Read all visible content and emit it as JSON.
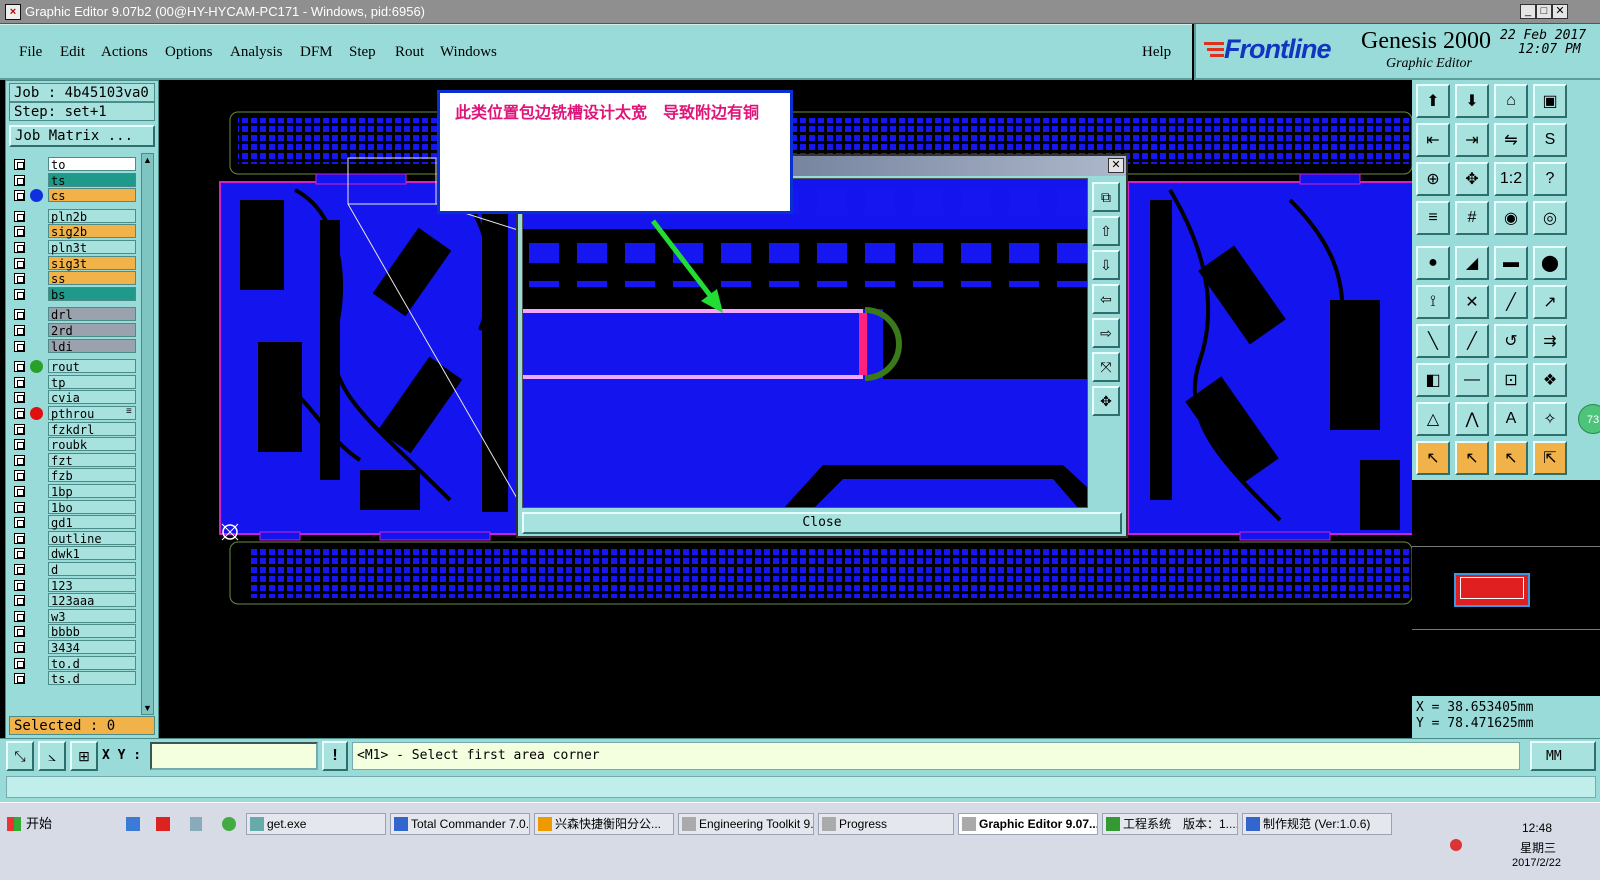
{
  "window": {
    "title": "Graphic Editor 9.07b2 (00@HY-HYCAM-PC171 - Windows, pid:6956)",
    "controls": [
      "_",
      "□",
      "✕"
    ]
  },
  "menu": {
    "items": [
      "File",
      "Edit",
      "Actions",
      "Options",
      "Analysis",
      "DFM",
      "Step",
      "Rout",
      "Windows"
    ],
    "help": "Help"
  },
  "brand": {
    "logo": "Frontline",
    "product": "Genesis 2000",
    "subtitle": "Graphic Editor",
    "date": "22 Feb 2017",
    "time": "12:07 PM"
  },
  "job": {
    "job_label": "Job : 4b45103va0",
    "step_label": "Step: set+1",
    "matrix_button": "Job Matrix ...",
    "selected": "Selected : 0"
  },
  "layers": [
    {
      "name": "to",
      "bg": "#ffffff",
      "dot": ""
    },
    {
      "name": "ts",
      "bg": "#1f9a8a",
      "dot": ""
    },
    {
      "name": "cs",
      "bg": "#f2b24a",
      "dot": "#1030e0"
    },
    {
      "name": "pln2b",
      "bg": "#a8e2df",
      "dot": ""
    },
    {
      "name": "sig2b",
      "bg": "#f2b24a",
      "dot": ""
    },
    {
      "name": "pln3t",
      "bg": "#a8e2df",
      "dot": ""
    },
    {
      "name": "sig3t",
      "bg": "#f2b24a",
      "dot": ""
    },
    {
      "name": "ss",
      "bg": "#f2b24a",
      "dot": ""
    },
    {
      "name": "bs",
      "bg": "#1f9a8a",
      "dot": ""
    },
    {
      "name": "drl",
      "bg": "#9aa3ad",
      "dot": ""
    },
    {
      "name": "2rd",
      "bg": "#9aa3ad",
      "dot": ""
    },
    {
      "name": "ldi",
      "bg": "#9aa3ad",
      "dot": ""
    },
    {
      "name": "rout",
      "bg": "#a8e2df",
      "dot": "#2aa02a"
    },
    {
      "name": "tp",
      "bg": "#a8e2df",
      "dot": ""
    },
    {
      "name": "cvia",
      "bg": "#a8e2df",
      "dot": ""
    },
    {
      "name": "pthrou",
      "bg": "#a8e2df",
      "dot": "#e01010",
      "mark": "≡"
    },
    {
      "name": "fzkdrl",
      "bg": "#a8e2df",
      "dot": ""
    },
    {
      "name": "roubk",
      "bg": "#a8e2df",
      "dot": ""
    },
    {
      "name": "fzt",
      "bg": "#a8e2df",
      "dot": ""
    },
    {
      "name": "fzb",
      "bg": "#a8e2df",
      "dot": ""
    },
    {
      "name": "1bp",
      "bg": "#a8e2df",
      "dot": ""
    },
    {
      "name": "1bo",
      "bg": "#a8e2df",
      "dot": ""
    },
    {
      "name": "gd1",
      "bg": "#a8e2df",
      "dot": ""
    },
    {
      "name": "outline",
      "bg": "#a8e2df",
      "dot": ""
    },
    {
      "name": "dwk1",
      "bg": "#a8e2df",
      "dot": ""
    },
    {
      "name": "d",
      "bg": "#a8e2df",
      "dot": ""
    },
    {
      "name": "123",
      "bg": "#a8e2df",
      "dot": ""
    },
    {
      "name": "123aaa",
      "bg": "#a8e2df",
      "dot": ""
    },
    {
      "name": "w3",
      "bg": "#a8e2df",
      "dot": ""
    },
    {
      "name": "bbbb",
      "bg": "#a8e2df",
      "dot": ""
    },
    {
      "name": "3434",
      "bg": "#a8e2df",
      "dot": ""
    },
    {
      "name": "to.d",
      "bg": "#a8e2df",
      "dot": ""
    },
    {
      "name": "ts.d",
      "bg": "#a8e2df",
      "dot": ""
    }
  ],
  "annotation": {
    "text": "此类位置包边铣槽设计太宽　导致附边有铜"
  },
  "zoom_popup": {
    "close_label": "Close",
    "close_x": "✕"
  },
  "coords": {
    "x": "X = 38.653405mm",
    "y": "Y = 78.471625mm"
  },
  "badge": "73",
  "bottom": {
    "xy_label": "X Y :",
    "xy_value": "",
    "warn": "!",
    "status": "<M1> - Select first area corner",
    "units": "MM"
  },
  "taskbar": {
    "start": "开始",
    "tasks": [
      "get.exe",
      "Total Commander 7.0...",
      "兴森快捷衡阳分公...",
      "Engineering Toolkit 9....",
      "Progress",
      "Graphic Editor 9.07...",
      "工程系统　版本：1....",
      "制作规范 (Ver:1.0.6)"
    ],
    "clock": "12:48",
    "weekday": "星期三",
    "date": "2017/2/22"
  },
  "colors": {
    "panel": "#99dbd8",
    "copper": "#1010f0",
    "title_text": "#e0157a"
  }
}
